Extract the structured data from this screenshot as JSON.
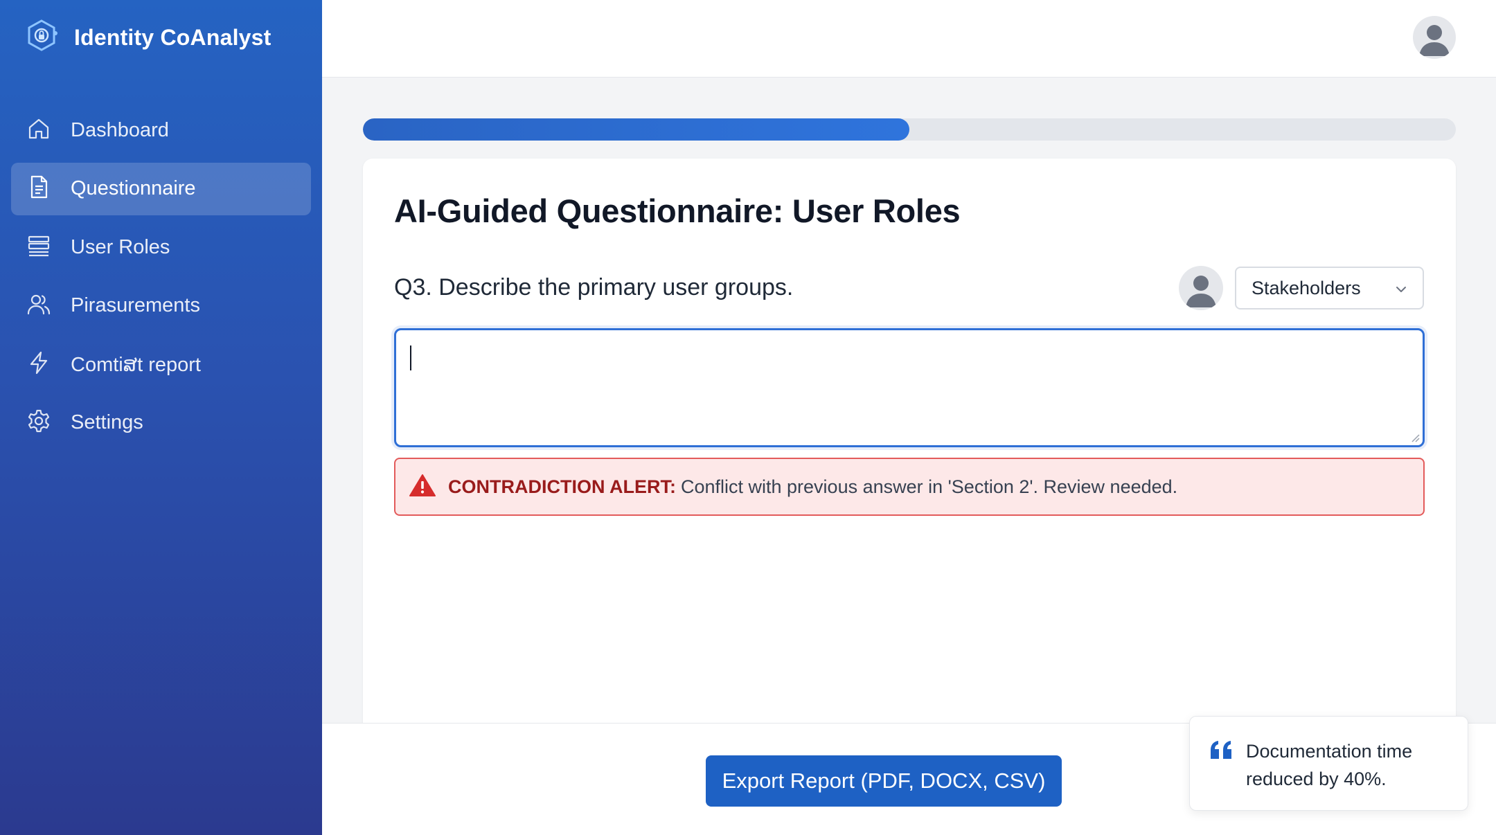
{
  "app": {
    "name": "Identity CoAnalyst"
  },
  "sidebar": {
    "items": [
      {
        "label": "Dashboard",
        "icon": "home-icon",
        "active": false
      },
      {
        "label": "Questionnaire",
        "icon": "document-icon",
        "active": true
      },
      {
        "label": "User Roles",
        "icon": "list-icon",
        "active": false
      },
      {
        "label": "Pirasurements",
        "icon": "users-icon",
        "active": false
      },
      {
        "label": "Comtiສt report",
        "icon": "lightning-icon",
        "active": false
      },
      {
        "label": "Settings",
        "icon": "gear-icon",
        "active": false
      }
    ]
  },
  "progress": {
    "value": 0.5
  },
  "questionnaire": {
    "title": "AI-Guided Questionnaire: User Roles",
    "question": "Q3. Describe the primary user groups.",
    "audience_select": {
      "value": "Stakeholders"
    },
    "answer": {
      "value": ""
    }
  },
  "alert": {
    "label": "CONTRADICTION ALERT:",
    "message": "Conflict with previous answer in 'Section 2'. Review needed."
  },
  "footer": {
    "export_label": "Export Report (PDF, DOCX, CSV)"
  },
  "toast": {
    "message": "Documentation time reduced by 40%."
  },
  "colors": {
    "sidebar": "#2a52b0",
    "accent": "#1e61c4",
    "alert_border": "#e35a5a",
    "alert_bg": "#fde8e8"
  }
}
